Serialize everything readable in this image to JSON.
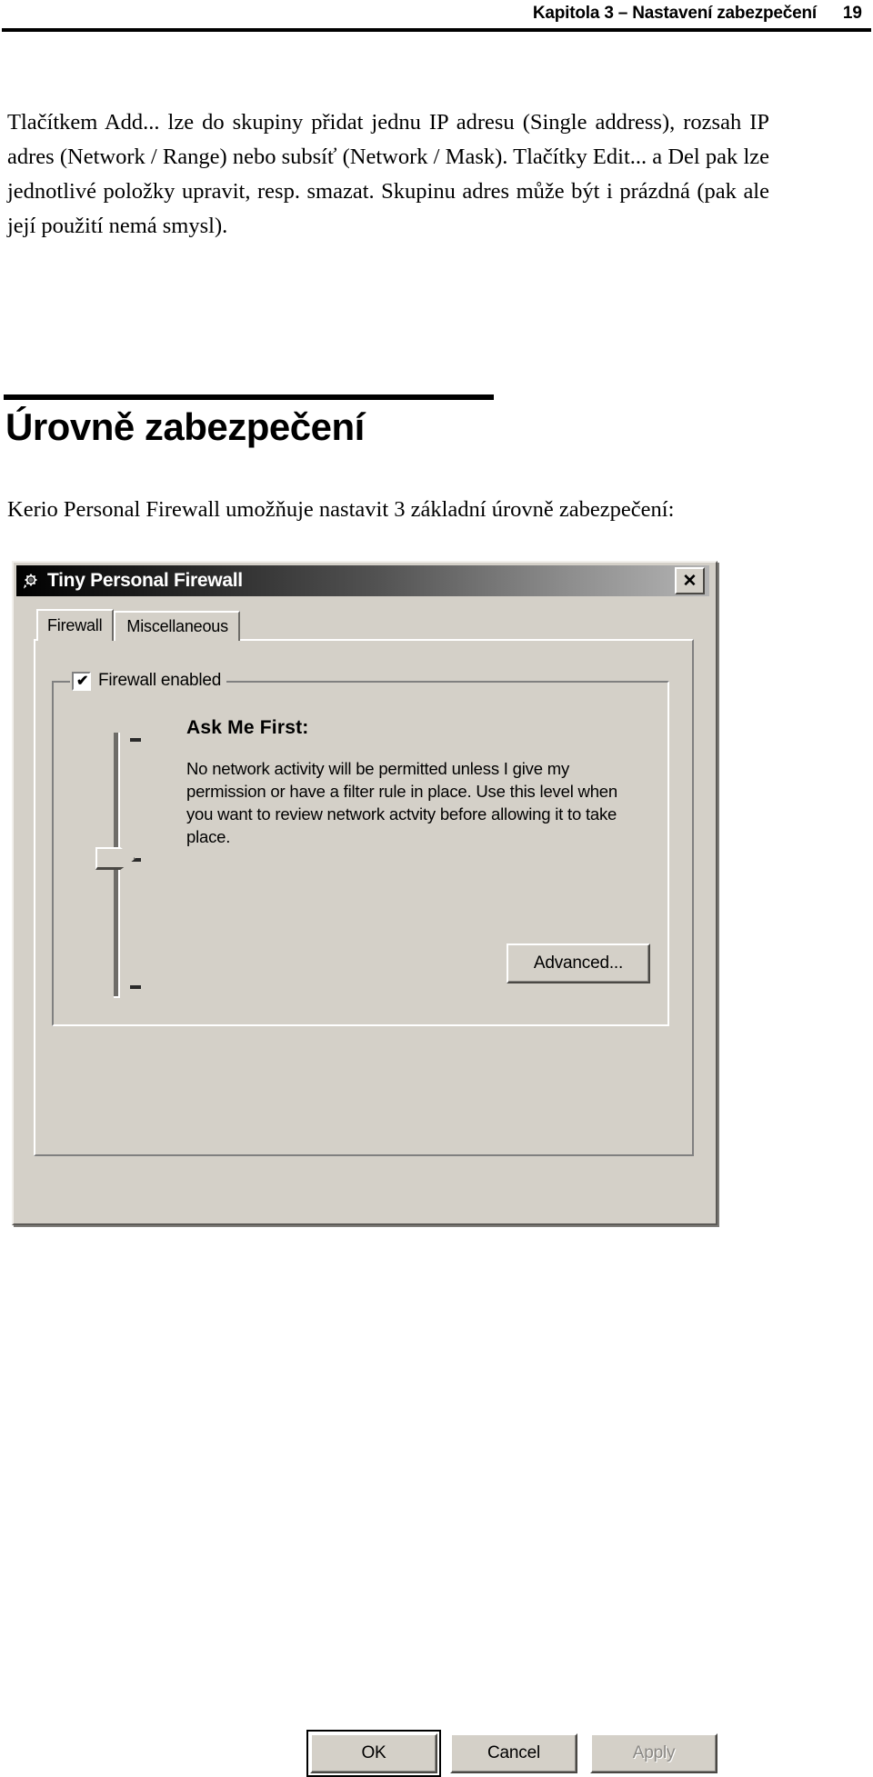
{
  "page": {
    "header_title": "Kapitola 3 – Nastavení zabezpečení",
    "page_number": "19",
    "body_paragraph": "Tlačítkem Add... lze do skupiny přidat jednu IP adresu (Single address), rozsah IP adres (Network / Range) nebo subsíť (Network / Mask). Tlačítky Edit... a Del pak lze jednotlivé položky upravit, resp. smazat. Skupinu adres může být i prázdná (pak ale její použití nemá smysl).",
    "section_heading": "Úrovně zabezpečení",
    "intro_paragraph": "Kerio Personal Firewall umožňuje nastavit 3 základní úrovně zabezpečení:"
  },
  "dialog": {
    "title": "Tiny Personal Firewall",
    "icon": "firewall-gear-icon",
    "close_label": "✕",
    "tabs": [
      {
        "label": "Firewall",
        "active": true
      },
      {
        "label": "Miscellaneous",
        "active": false
      }
    ],
    "group": {
      "caption": "Firewall enabled",
      "checked": true,
      "check_glyph": "✔"
    },
    "slider": {
      "name": "security-level-slider",
      "orientation": "vertical",
      "tick_count": 3,
      "position": "middle",
      "value_label": "Ask Me First"
    },
    "level": {
      "title": "Ask Me First:",
      "description": "No network activity will be permitted unless I give my permission or have a filter rule in place. Use this level when you want to review network actvity before allowing it to take place."
    },
    "buttons": {
      "advanced": "Advanced...",
      "ok": "OK",
      "cancel": "Cancel",
      "apply": "Apply",
      "apply_disabled": true
    }
  },
  "colors": {
    "dialog_face": "#d4d0c8",
    "titlebar_dark": "#000000",
    "titlebar_light": "#b4b4b4",
    "disabled_text": "#8a8884"
  }
}
